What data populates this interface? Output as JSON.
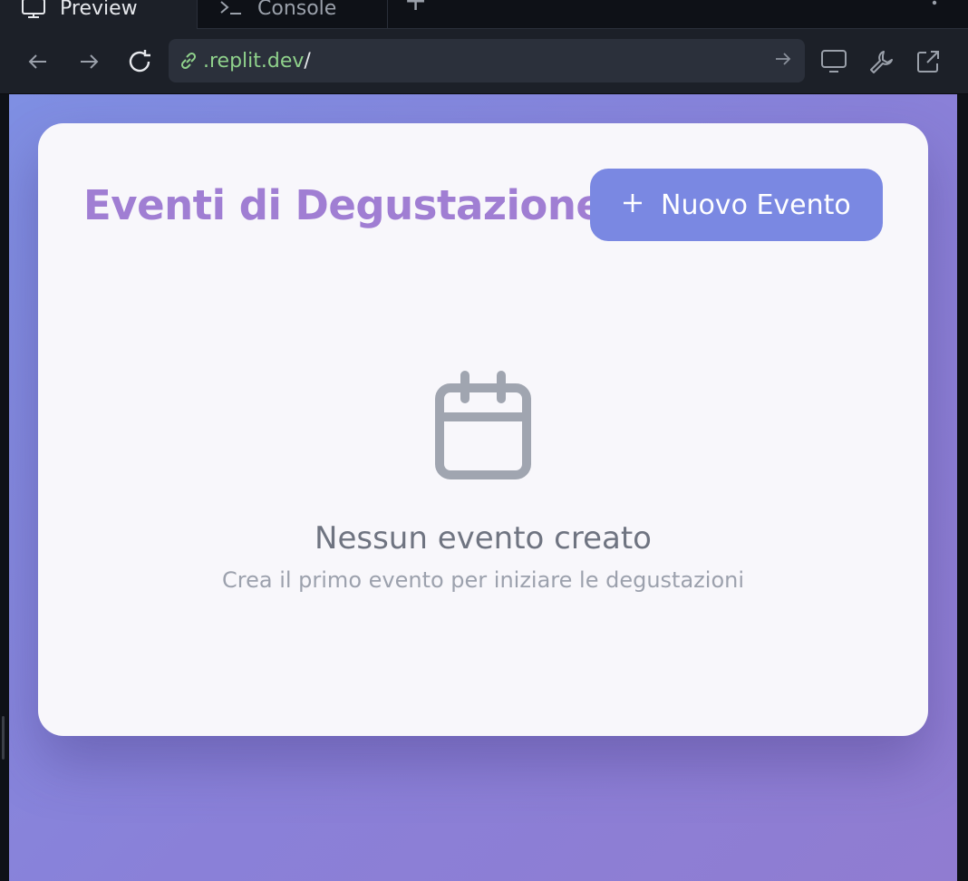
{
  "tabs": {
    "preview_label": "Preview",
    "console_label": "Console",
    "add_label": "+"
  },
  "address": {
    "host": ".replit.dev",
    "path": "/"
  },
  "main": {
    "title": "Eventi di Degustazione",
    "new_event_label": "Nuovo Evento",
    "empty_title": "Nessun evento creato",
    "empty_subtitle": "Crea il primo evento per iniziare le degustazioni"
  },
  "colors": {
    "title": "#a07ed3",
    "button": "#7a88e2",
    "background_start": "#7f8fe3",
    "background_end": "#907cd1",
    "url_host": "#8fd18b"
  }
}
